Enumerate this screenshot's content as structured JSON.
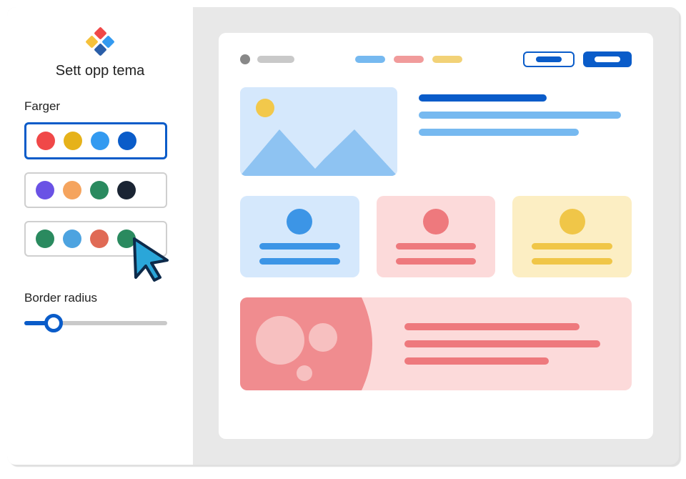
{
  "sidebar": {
    "title": "Sett opp tema",
    "colors_label": "Farger",
    "palettes": [
      {
        "selected": true,
        "swatches": [
          "#f04848",
          "#e6b21a",
          "#339af0",
          "#0a5cc9"
        ]
      },
      {
        "selected": false,
        "swatches": [
          "#6a52e5",
          "#f5a45e",
          "#2a8a5f",
          "#1a2433"
        ]
      },
      {
        "selected": false,
        "swatches": [
          "#2a8a5f",
          "#4da3e0",
          "#e06a55",
          "#2a8a5f"
        ]
      }
    ],
    "border_radius_label": "Border radius",
    "border_radius_value": 18
  },
  "preview_colors": {
    "nav_dot": "#888888",
    "nav_text": "#c9c9c9",
    "nav_pills": [
      "#76b9f0",
      "#f19b9b",
      "#f2d277"
    ],
    "btn_outline_border": "#0a5cc9",
    "btn_outline_fill": "#0a5cc9",
    "btn_solid_bg": "#0a5cc9",
    "btn_solid_fill": "#ffffff",
    "hero_bg": "#d5e8fc",
    "hero_sun": "#f2c84b",
    "hero_mtn": "#8ec3f2",
    "hero_title": "#0a5cc9",
    "hero_text": "#76b9f0",
    "card1_bg": "#d5e8fc",
    "card1_accent": "#3c95e6",
    "card2_bg": "#fcdada",
    "card2_accent": "#ee797d",
    "card3_bg": "#fceec3",
    "card3_accent": "#f0c648",
    "banner_bg": "#fcdada",
    "banner_shape": "#f08c8f",
    "banner_circ": "#f7c0c0",
    "banner_line": "#ee797d"
  }
}
